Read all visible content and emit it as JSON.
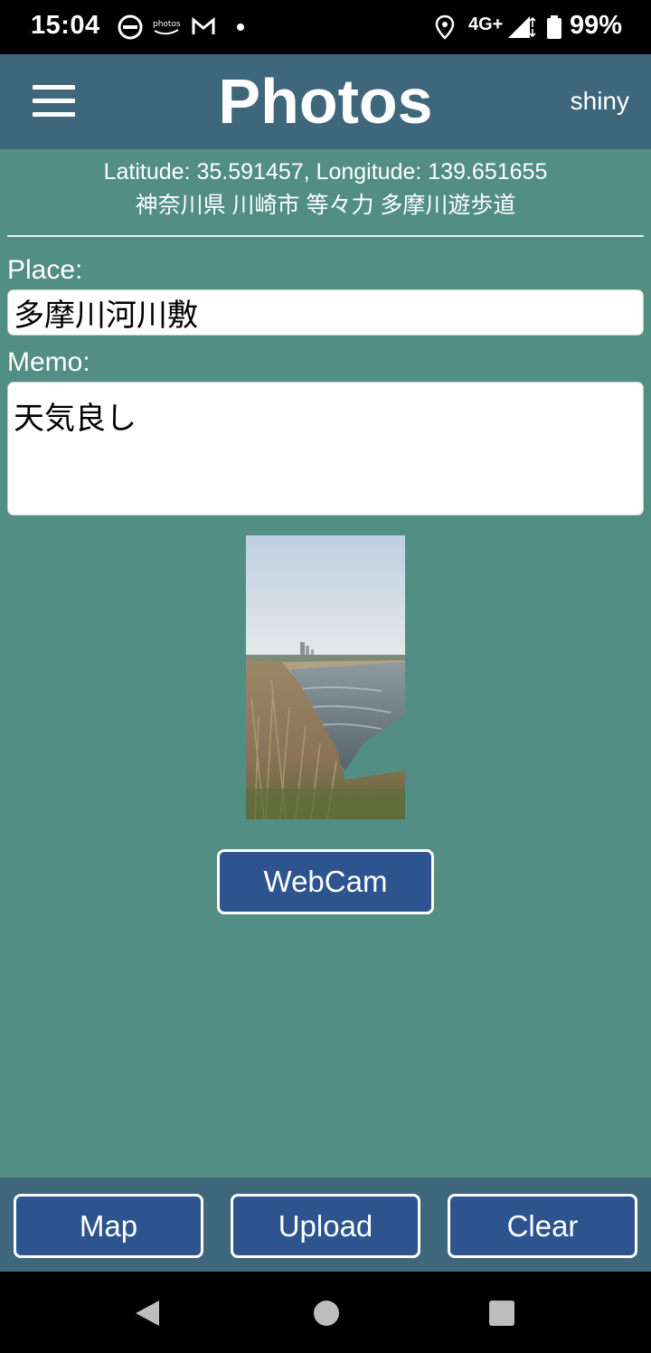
{
  "status_bar": {
    "time": "15:04",
    "network": "4G+",
    "battery": "99%",
    "icons": [
      "do-not-disturb-icon",
      "amazon-photos-icon",
      "gmail-icon",
      "notification-dot-icon",
      "location-icon",
      "signal-icon",
      "battery-icon"
    ]
  },
  "header": {
    "title": "Photos",
    "user": "shiny"
  },
  "location": {
    "coords": "Latitude: 35.591457, Longitude: 139.651655",
    "address": "神奈川県 川崎市 等々力 多摩川遊歩道"
  },
  "form": {
    "place_label": "Place:",
    "place_value": "多摩川河川敷",
    "memo_label": "Memo:",
    "memo_value": "天気良し"
  },
  "webcam_label": "WebCam",
  "bottom_buttons": {
    "map": "Map",
    "upload": "Upload",
    "clear": "Clear"
  },
  "colors": {
    "background": "#528e84",
    "header": "#3f677c",
    "button": "#2d548e"
  }
}
